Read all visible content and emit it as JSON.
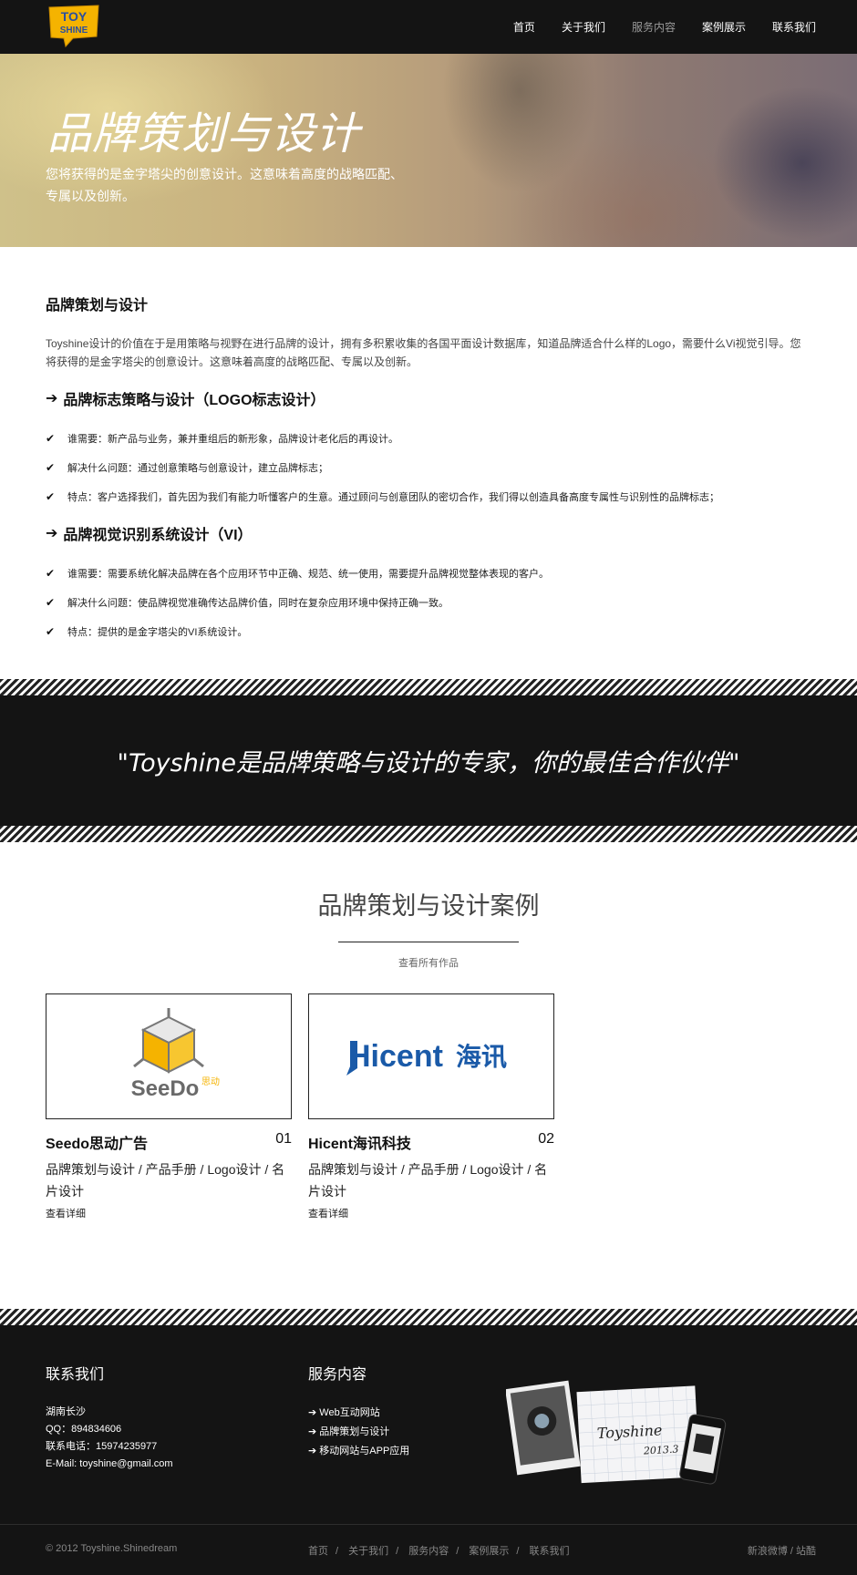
{
  "header": {
    "logo_top": "TOY",
    "logo_bottom": "SHINE",
    "nav": [
      "首页",
      "关于我们",
      "服务内容",
      "案例展示",
      "联系我们"
    ]
  },
  "hero": {
    "title": "品牌策划与设计",
    "subtitle": "您将获得的是金字塔尖的创意设计。这意味着高度的战略匹配、专属以及创新。"
  },
  "content": {
    "heading": "品牌策划与设计",
    "intro": "Toyshine设计的价值在于是用策略与视野在进行品牌的设计，拥有多积累收集的各国平面设计数据库，知道品牌适合什么样的Logo，需要什么Vi视觉引导。您将获得的是金字塔尖的创意设计。这意味着高度的战略匹配、专属以及创新。",
    "section1": {
      "title": "品牌标志策略与设计（LOGO标志设计）",
      "items": [
        "谁需要：新产品与业务，兼并重组后的新形象，品牌设计老化后的再设计。",
        "解决什么问题：通过创意策略与创意设计，建立品牌标志；",
        "特点：客户选择我们，首先因为我们有能力听懂客户的生意。通过顾问与创意团队的密切合作，我们得以创造具备高度专属性与识别性的品牌标志；"
      ]
    },
    "section2": {
      "title": "品牌视觉识别系统设计（VI）",
      "items": [
        "谁需要：需要系统化解决品牌在各个应用环节中正确、规范、统一使用，需要提升品牌视觉整体表现的客户。",
        "解决什么问题：使品牌视觉准确传达品牌价值，同时在复杂应用环境中保持正确一致。",
        "特点：提供的是金字塔尖的VI系统设计。"
      ]
    }
  },
  "quote": "\"Toyshine是品牌策略与设计的专家，你的最佳合作伙伴\"",
  "cases": {
    "title": "品牌策划与设计案例",
    "view_all": "查看所有作品",
    "items": [
      {
        "name": "Seedo思动广告",
        "num": "01",
        "tags": "品牌策划与设计 / 产品手册 / Logo设计 / 名片设计",
        "more": "查看详细",
        "logo_text": "SeeDo",
        "logo_cn": "思动"
      },
      {
        "name": "Hicent海讯科技",
        "num": "02",
        "tags": "品牌策划与设计 / 产品手册 / Logo设计 / 名片设计",
        "more": "查看详细",
        "logo_text": "Hicent",
        "logo_cn": "海讯"
      }
    ]
  },
  "footer": {
    "contact_title": "联系我们",
    "contact_lines": [
      "湖南长沙",
      "QQ：894834606",
      "联系电话：15974235977",
      "E-Mail: toyshine@gmail.com"
    ],
    "services_title": "服务内容",
    "services": [
      "Web互动网站",
      "品牌策划与设计",
      "移动网站与APP应用"
    ],
    "photo_text": "Toyshine",
    "photo_date": "2013.3",
    "copyright": "© 2012 Toyshine.Shinedream",
    "bottom_nav": [
      "首页",
      "关于我们",
      "服务内容",
      "案例展示",
      "联系我们"
    ],
    "social": [
      "新浪微博",
      "站酷"
    ]
  },
  "colors": {
    "dark": "#141414",
    "logo_yellow": "#f5b300",
    "hicent_blue": "#1a5aa8"
  }
}
